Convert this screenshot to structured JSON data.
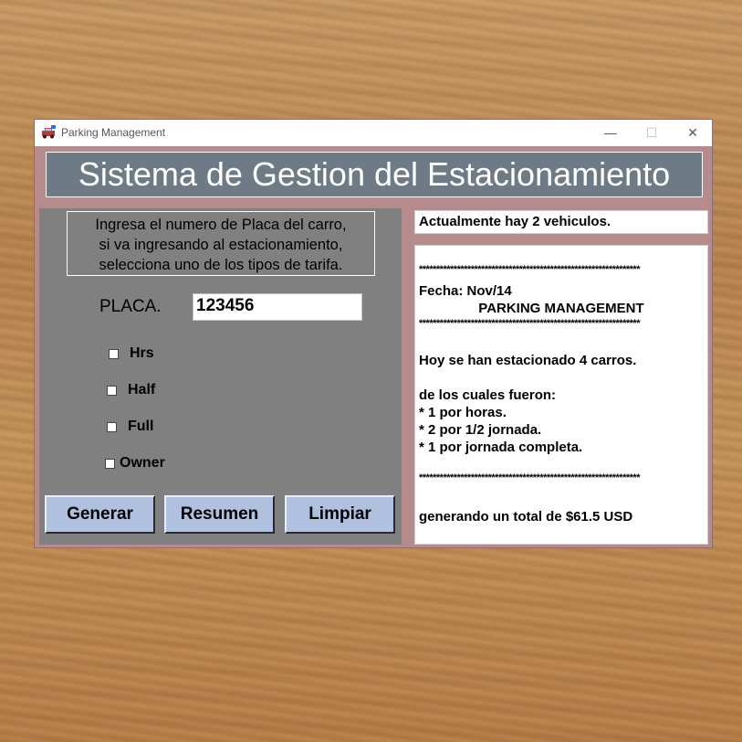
{
  "window": {
    "title": "Parking Management",
    "controls": {
      "minimize": "—",
      "maximize": "☐",
      "close": "✕"
    }
  },
  "banner": {
    "title": "Sistema de Gestion del Estacionamiento"
  },
  "form": {
    "instructions": "Ingresa el numero de Placa del carro,\nsi  va ingresando  al estacionamiento,\nselecciona  uno de los  tipos de tarifa.",
    "plate_label": "PLACA.",
    "plate_value": "123456",
    "options": {
      "hrs": "Hrs",
      "half": "Half",
      "full": "Full",
      "owner": "Owner"
    }
  },
  "buttons": {
    "generar": "Generar",
    "resumen": "Resumen",
    "limpiar": "Limpiar"
  },
  "status": {
    "text": "Actualmente hay 2 vehiculos."
  },
  "summary": {
    "stars": "****************************************************************",
    "fecha": "Fecha: Nov/14",
    "heading": "PARKING MANAGEMENT",
    "parked": "Hoy se han estacionado 4 carros.",
    "of_which": "de los cuales fueron:",
    "hours": "* 1 por horas.",
    "half": "* 2 por 1/2 jornada.",
    "full": "* 1 por jornada completa.",
    "total": "generando un total de $61.5 USD"
  },
  "icons": {
    "app": "car-icon"
  }
}
